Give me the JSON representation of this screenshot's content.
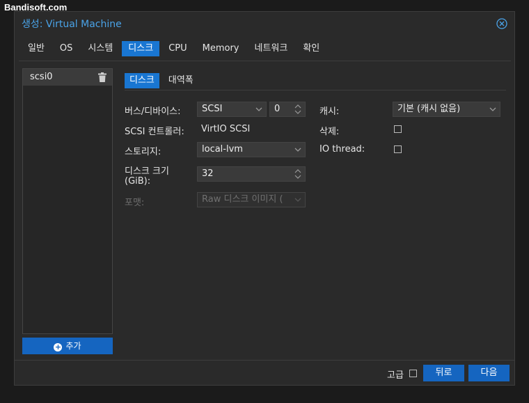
{
  "watermark": "Bandisoft.com",
  "window": {
    "title": "생성: Virtual Machine",
    "close_icon": "close-circle-icon"
  },
  "tabs": [
    {
      "label": "일반"
    },
    {
      "label": "OS"
    },
    {
      "label": "시스템"
    },
    {
      "label": "디스크",
      "active": true
    },
    {
      "label": "CPU"
    },
    {
      "label": "Memory"
    },
    {
      "label": "네트워크"
    },
    {
      "label": "확인"
    }
  ],
  "disk_list": {
    "items": [
      {
        "label": "scsi0"
      }
    ],
    "add_label": "추가"
  },
  "subtabs": [
    {
      "label": "디스크",
      "active": true
    },
    {
      "label": "대역폭"
    }
  ],
  "form": {
    "bus_label": "버스/디바이스:",
    "bus_value": "SCSI",
    "device_value": "0",
    "controller_label": "SCSI 컨트롤러:",
    "controller_value": "VirtIO SCSI",
    "storage_label": "스토리지:",
    "storage_value": "local-lvm",
    "size_label_1": "디스크 크기",
    "size_label_2": "(GiB):",
    "size_value": "32",
    "format_label": "포맷:",
    "format_value": "Raw 디스크 이미지 (",
    "cache_label": "캐시:",
    "cache_value": "기본 (캐시 없음)",
    "discard_label": "삭제:",
    "discard_checked": false,
    "iothread_label": "IO thread:",
    "iothread_checked": false
  },
  "footer": {
    "advanced_label": "고급",
    "advanced_checked": false,
    "back_label": "뒤로",
    "next_label": "다음"
  },
  "colors": {
    "accent": "#1976d2",
    "title": "#4aa3e8",
    "bg": "#2a2a2a"
  }
}
